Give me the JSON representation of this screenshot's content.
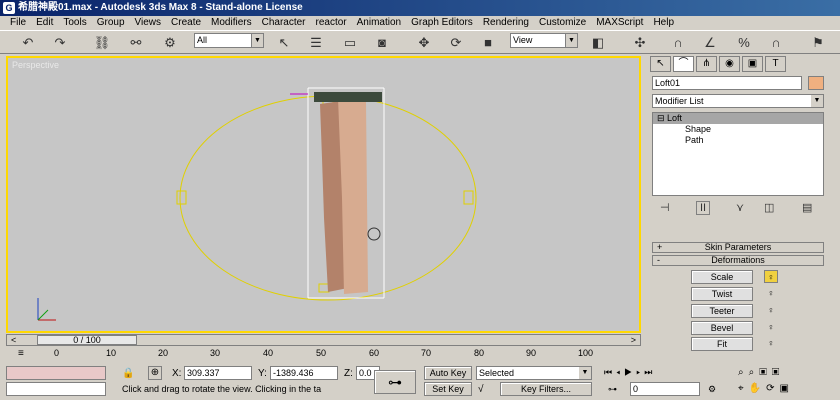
{
  "window": {
    "title": "希腊神殿01.max - Autodesk 3ds Max 8 - Stand-alone License"
  },
  "menu": [
    "File",
    "Edit",
    "Tools",
    "Group",
    "Views",
    "Create",
    "Modifiers",
    "Character",
    "reactor",
    "Animation",
    "Graph Editors",
    "Rendering",
    "Customize",
    "MAXScript",
    "Help"
  ],
  "toolbar": {
    "selection_filter": "All",
    "reference_coord": "View"
  },
  "viewport": {
    "label": "Perspective"
  },
  "panel": {
    "object_name": "Loft01",
    "modifier_list": "Modifier List",
    "stack": [
      "Loft",
      "Shape",
      "Path"
    ],
    "rollouts": {
      "skin": "Skin Parameters",
      "deformations": "Deformations"
    },
    "deform_buttons": [
      "Scale",
      "Twist",
      "Teeter",
      "Bevel",
      "Fit"
    ]
  },
  "timeline": {
    "frame": "0 / 100",
    "ticks": [
      "0",
      "10",
      "20",
      "30",
      "40",
      "50",
      "60",
      "70",
      "80",
      "90",
      "100"
    ]
  },
  "status": {
    "x_label": "X:",
    "x_value": "309.337",
    "y_label": "Y:",
    "y_value": "-1389.436",
    "z_label": "Z:",
    "z_value": "0.0",
    "prompt": "Click and drag to rotate the view.  Clicking in the ta",
    "auto_key": "Auto Key",
    "set_key": "Set Key",
    "key_mode": "Selected",
    "key_filters": "Key Filters...",
    "current_frame": "0"
  },
  "colors": {
    "viewport_border": "#ffd800",
    "column": "#c8967a",
    "orbit": "#e0d000"
  }
}
